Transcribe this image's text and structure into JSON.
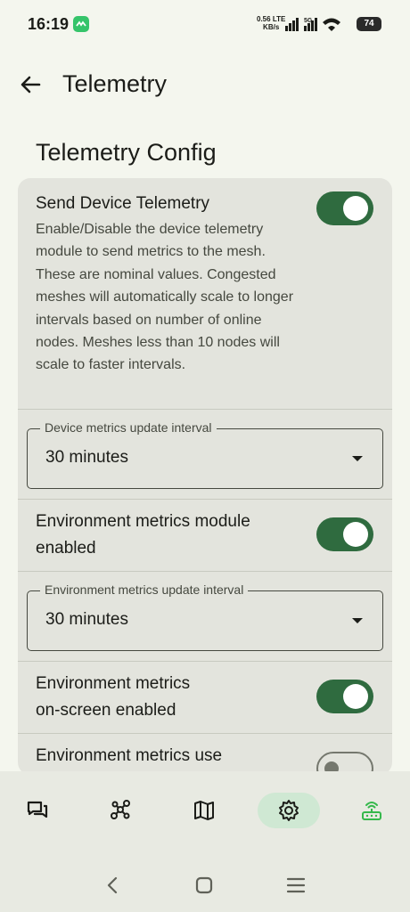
{
  "status_bar": {
    "time": "16:19",
    "speed_value": "0.56",
    "speed_unit": "KB/s",
    "net_type_1": "LTE",
    "net_type_2": "5G",
    "battery": "74"
  },
  "top_bar": {
    "title": "Telemetry",
    "back_icon": "arrow-back-icon"
  },
  "section": {
    "title": "Telemetry Config"
  },
  "settings": {
    "send_device_telemetry": {
      "title": "Send Device Telemetry",
      "description": "Enable/Disable the device telemetry module to send metrics to the mesh. These are nominal values. Congested meshes will automatically scale to longer intervals based on number of online nodes. Meshes less than 10 nodes will scale to faster intervals.",
      "enabled": true
    },
    "device_metrics_interval": {
      "label": "Device metrics update interval",
      "value": "30 minutes"
    },
    "environment_module": {
      "title_line1": "Environment metrics module",
      "title_line2": "enabled",
      "enabled": true
    },
    "environment_interval": {
      "label": "Environment metrics update interval",
      "value": "30 minutes"
    },
    "environment_onscreen": {
      "title_line1": "Environment metrics",
      "title_line2": "on-screen enabled",
      "enabled": true
    },
    "environment_use": {
      "title_line1": "Environment metrics use",
      "enabled": false
    }
  },
  "bottom_nav": {
    "items": [
      {
        "icon": "chat-icon",
        "active": false
      },
      {
        "icon": "nodes-icon",
        "active": false
      },
      {
        "icon": "map-icon",
        "active": false
      },
      {
        "icon": "settings-gear-icon",
        "active": true
      },
      {
        "icon": "router-connected-icon",
        "active": false
      }
    ]
  },
  "colors": {
    "accent": "#2f6b3f",
    "router_icon": "#35b84c",
    "active_nav_bg": "#cfe8d3"
  }
}
